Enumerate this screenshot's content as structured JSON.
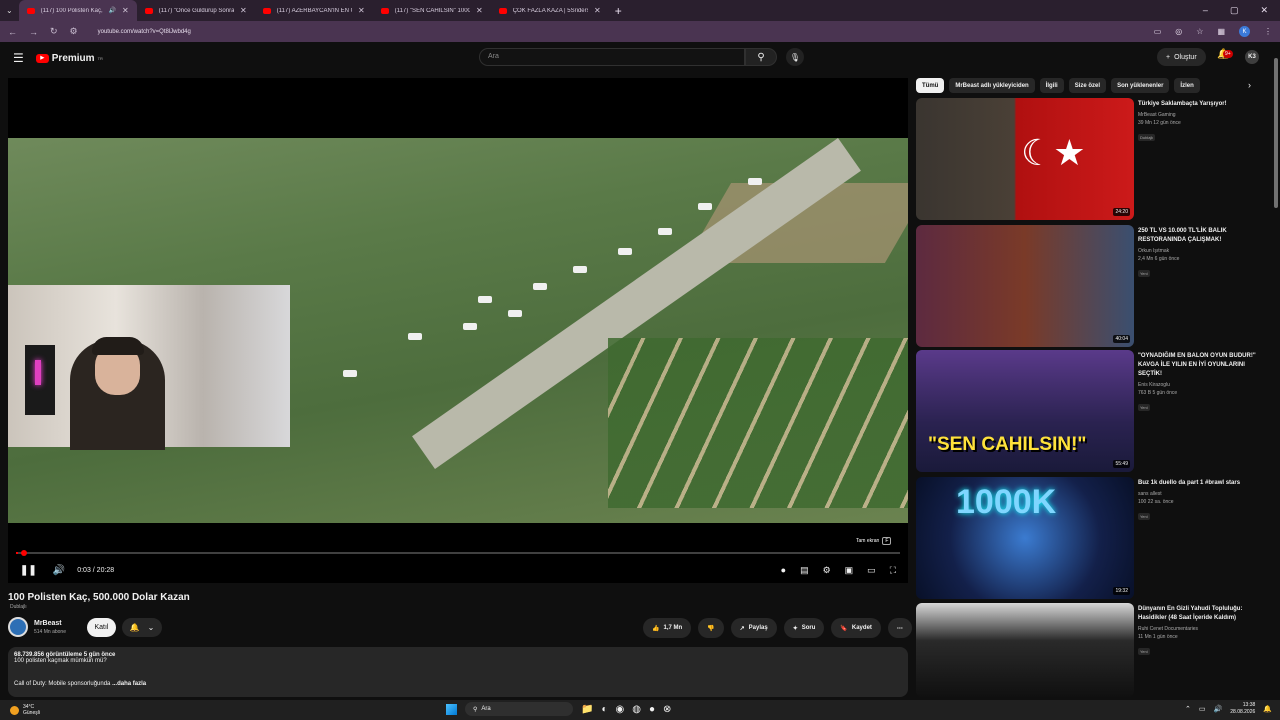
{
  "browser": {
    "tabs": [
      {
        "title": "(117) 100 Polisten Kaç, 500"
      },
      {
        "title": "(117) \"Önce Güldürüp Sonra D"
      },
      {
        "title": "(117) AZERBAYCAN'IN EN GÜÇ"
      },
      {
        "title": "(117) \"SEN CAHİLSİN\" 1000 K"
      },
      {
        "title": "ÇOK FAZLA KAZA | 5Sriders | M"
      }
    ],
    "url": "youtube.com/watch?v=Qt8lJwbd4g",
    "profile_initial": "K"
  },
  "header": {
    "logo_text": "Premium",
    "logo_sup": "TR",
    "search_placeholder": "Ara",
    "create_label": "Oluştur",
    "notif_count": "9+",
    "avatar_text": "K3"
  },
  "player": {
    "fullscreen_tip": "Tam ekran",
    "fullscreen_key": "F",
    "time": "0:03 / 20:28",
    "progress_fraction": 0.0025
  },
  "video": {
    "title": "100 Polisten Kaç, 500.000 Dolar Kazan",
    "dubbed": "Dublajlı",
    "channel_name": "MrBeast",
    "subscribers": "514 Mn abone",
    "join_label": "Katıl",
    "likes": "1,7 Mn",
    "share_label": "Paylaş",
    "ask_label": "Soru",
    "save_label": "Kaydet",
    "views_line": "68.739.856 görüntüleme  5 gün önce",
    "desc_line": "100 polisten kaçmak mümkün mü?",
    "desc_line2": "Call of Duty: Mobile sponsorluğunda",
    "more_label": "...daha fazla"
  },
  "chips": [
    "Tümü",
    "MrBeast adlı yükleyiciden",
    "İlgili",
    "Size özel",
    "Son yüklenenler",
    "İzlen"
  ],
  "recommendations": [
    {
      "title": "Türkiye Saklambaçta Yarışıyor!",
      "channel": "MrBeast Gaming",
      "views": "39 Mn  12 gün önce",
      "badge": "Dublajlı",
      "duration": "24:20"
    },
    {
      "title": "250 TL VS 10.000 TL'LİK BALIK RESTORANINDA ÇALIŞMAK!",
      "channel": "Orkun Işıtmak",
      "views": "2,4 Mn  6 gün önce",
      "badge": "Yeni",
      "duration": "40:04"
    },
    {
      "title": "\"OYNADIĞIM EN BALON OYUN BUDUR!\" KAVGA İLE YILIN EN İYİ OYUNLARINI SEÇTİK!",
      "channel": "Enis Kirazoglu",
      "views": "763 B  5 gün önce",
      "badge": "Yeni",
      "duration": "55:49"
    },
    {
      "title": "Buz 1k duello da part 1 #brawl stars",
      "channel": "sans allest",
      "views": "100  22 sa. önce",
      "badge": "Yeni",
      "duration": "19:32"
    },
    {
      "title": "Dünyanın En Gizli Yahudi Topluluğu: Hasidikler (48 Saat İçeride Kaldım)",
      "channel": "Ruhi Cenet Documentaries",
      "views": "11 Mn  1 gün önce",
      "badge": "Yeni",
      "duration": ""
    }
  ],
  "taskbar": {
    "weather_temp": "34°C",
    "weather_desc": "Güneşli",
    "search_label": "Ara",
    "time": "13:38",
    "date": "28.08.2026"
  }
}
